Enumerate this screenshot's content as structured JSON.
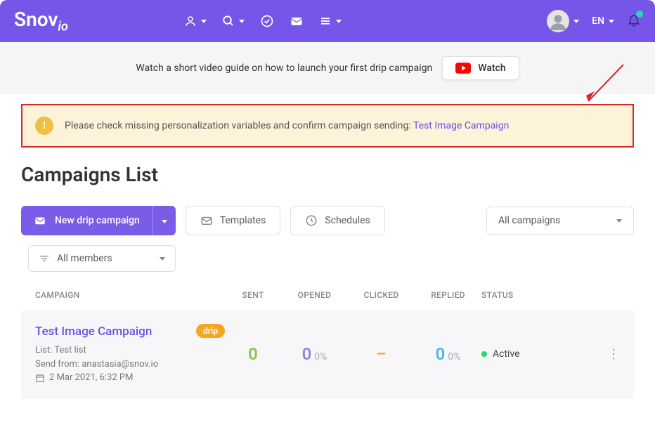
{
  "header": {
    "logo_main": "Snov",
    "logo_suffix": "io",
    "lang": "EN"
  },
  "video_banner": {
    "text": "Watch a short video guide on how to launch your first drip campaign",
    "button": "Watch"
  },
  "warning": {
    "icon": "!",
    "text": "Please check missing personalization variables and confirm campaign sending: ",
    "link_text": "Test Image Campaign"
  },
  "page_title": "Campaigns List",
  "actions": {
    "new_campaign": "New drip campaign",
    "templates": "Templates",
    "schedules": "Schedules",
    "filter": "All campaigns",
    "members": "All members"
  },
  "table": {
    "headers": {
      "campaign": "CAMPAIGN",
      "sent": "SENT",
      "opened": "OPENED",
      "clicked": "CLICKED",
      "replied": "REPLIED",
      "status": "STATUS"
    },
    "rows": [
      {
        "name": "Test Image Campaign",
        "badge": "drip",
        "list": "List: Test list",
        "sender": "Send from: anastasia@snov.io",
        "date": "2 Mar 2021, 6:32 PM",
        "sent": "0",
        "opened": "0",
        "opened_pct": "0%",
        "clicked": "–",
        "replied": "0",
        "replied_pct": "0%",
        "status": "Active"
      }
    ]
  }
}
